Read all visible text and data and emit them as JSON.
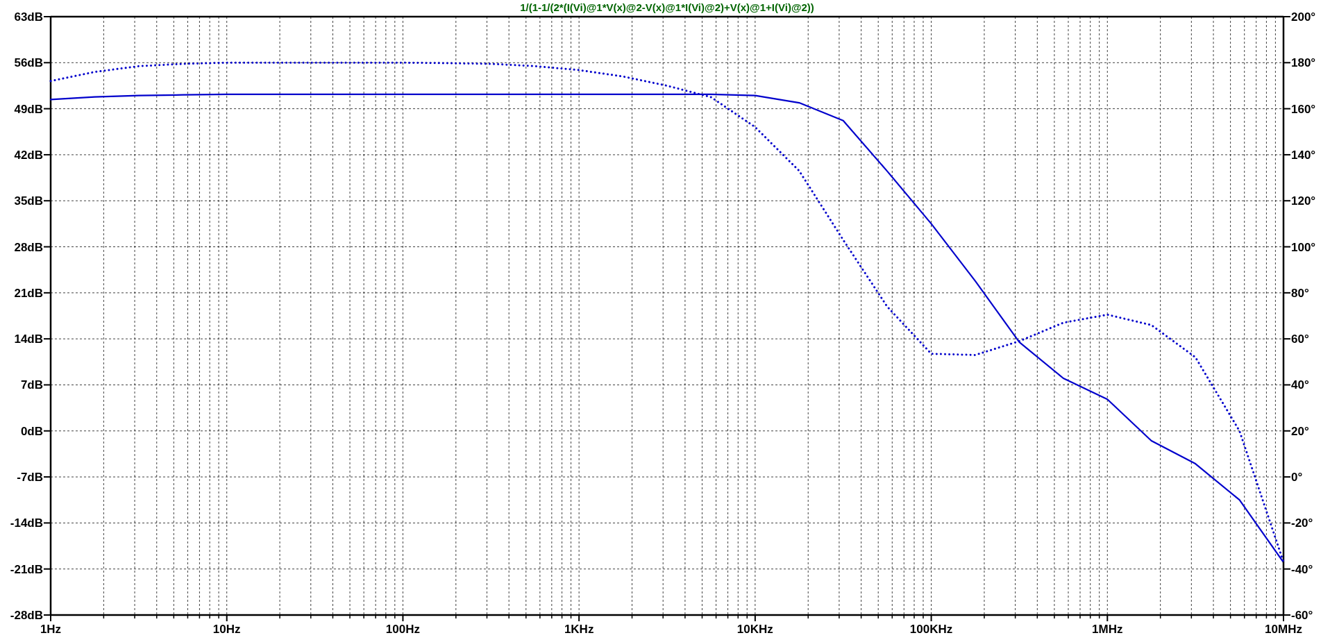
{
  "title": "1/(1-1/(2*(I(Vi)@1*V(x)@2-V(x)@1*I(Vi)@2)+V(x)@1+I(Vi)@2))",
  "magnitude_chart": {
    "chart_data": {
      "type": "line",
      "categories": [
        "1Hz",
        null,
        null,
        null,
        "10Hz",
        null,
        null,
        null,
        "100Hz",
        null,
        null,
        null,
        "1KHz",
        null,
        null,
        null,
        "10KHz",
        null,
        null,
        null,
        "100KHz",
        null,
        null,
        null,
        "1MHz",
        null,
        null,
        null,
        "10MHz"
      ],
      "ylim": [
        -28,
        63
      ],
      "grid": true,
      "yticks": [
        {
          "value": 63,
          "label": "63dB"
        },
        {
          "value": 56,
          "label": "56dB"
        },
        {
          "value": 49,
          "label": "49dB"
        },
        {
          "value": 42,
          "label": "42dB"
        },
        {
          "value": 35,
          "label": "35dB"
        },
        {
          "value": 28,
          "label": "28dB"
        },
        {
          "value": 21,
          "label": "21dB"
        },
        {
          "value": 14,
          "label": "14dB"
        },
        {
          "value": 7,
          "label": "7dB"
        },
        {
          "value": 0,
          "label": "0dB"
        },
        {
          "value": -7,
          "label": "-7dB"
        },
        {
          "value": -14,
          "label": "-14dB"
        },
        {
          "value": -21,
          "label": "-21dB"
        },
        {
          "value": -28,
          "label": "-28dB"
        }
      ],
      "series": [
        {
          "color": "#0000cc",
          "values": [
            50.4,
            50.8,
            51.0,
            51.1,
            51.2,
            51.2,
            51.2,
            51.2,
            51.2,
            51.2,
            51.2,
            51.2,
            51.2,
            51.2,
            51.2,
            51.2,
            51.0,
            49.9,
            47.2,
            39.5,
            31.5,
            22.8,
            13.5,
            8.0,
            4.8,
            -1.5,
            -5.0,
            -10.5,
            -20.0
          ]
        }
      ]
    }
  },
  "phase_chart": {
    "chart_data": {
      "type": "line",
      "categories": [
        null,
        null,
        null,
        null,
        null,
        null,
        null,
        null,
        null,
        null,
        null,
        null,
        null,
        null,
        null,
        null,
        null,
        null,
        null,
        null,
        null,
        null,
        null,
        null,
        null,
        null,
        null,
        null,
        null
      ],
      "ylim": [
        -60,
        200
      ],
      "yticks": [
        {
          "value": 200,
          "label": "200°"
        },
        {
          "value": 180,
          "label": "180°"
        },
        {
          "value": 160,
          "label": "160°"
        },
        {
          "value": 140,
          "label": "140°"
        },
        {
          "value": 120,
          "label": "120°"
        },
        {
          "value": 100,
          "label": "100°"
        },
        {
          "value": 80,
          "label": "80°"
        },
        {
          "value": 60,
          "label": "60°"
        },
        {
          "value": 40,
          "label": "40°"
        },
        {
          "value": 20,
          "label": "20°"
        },
        {
          "value": 0,
          "label": "0°"
        },
        {
          "value": -20,
          "label": "-20°"
        },
        {
          "value": -40,
          "label": "-40°"
        },
        {
          "value": -60,
          "label": "-60°"
        }
      ],
      "series": [
        {
          "color": "#0000cc",
          "line_style": "dotted",
          "values": [
            172,
            176,
            178.5,
            179.5,
            180,
            180,
            180,
            180,
            180,
            179.8,
            179.5,
            178.5,
            176.8,
            174,
            170,
            165,
            152,
            133,
            103,
            74,
            53.5,
            53,
            59,
            67,
            70.5,
            66,
            52,
            20,
            -37
          ]
        }
      ]
    }
  }
}
